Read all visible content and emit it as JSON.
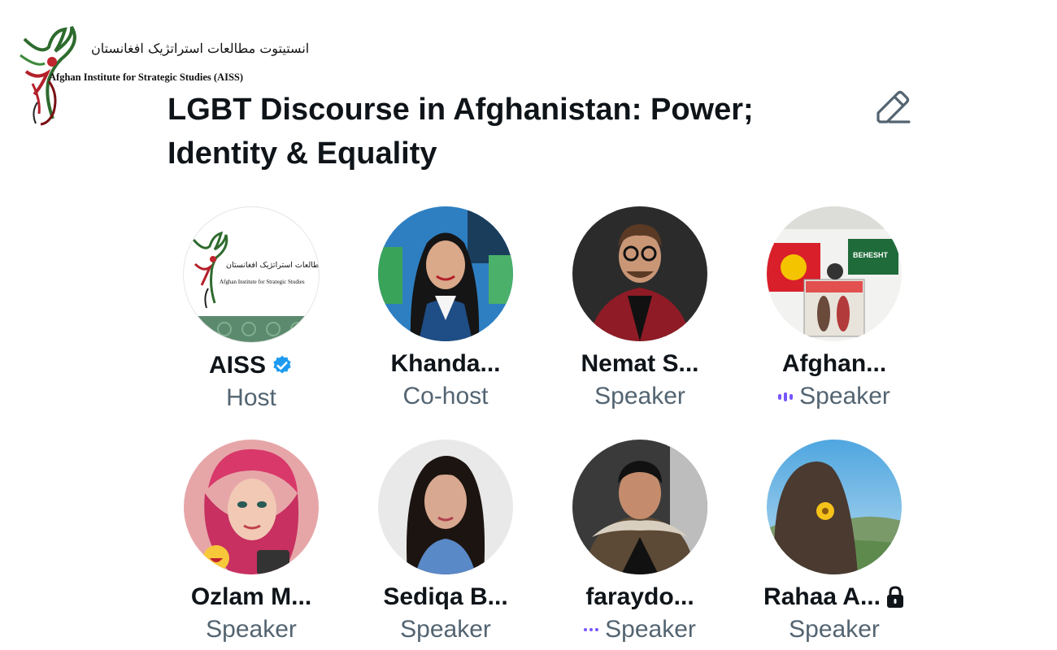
{
  "watermark": {
    "persian": "انستیتوت مطالعات استراتژیک افغانستان",
    "english": "Afghan Institute for Strategic Studies (AISS)"
  },
  "space": {
    "title_line1": "LGBT Discourse in Afghanistan: Power;",
    "title_line2": "Identity & Equality"
  },
  "participants": [
    {
      "name": "AISS",
      "role": "Host",
      "verified": true,
      "logo_persian": "انستیتوت مطالعات استراتژیک افغانستان",
      "logo_english": "Afghan Institute for Strategic Studies"
    },
    {
      "name": "Khanda...",
      "role": "Co-host"
    },
    {
      "name": "Nemat S...",
      "role": "Speaker"
    },
    {
      "name": "Afghan...",
      "role": "Speaker",
      "status": "speaking",
      "poster_text": "BEHESHT"
    },
    {
      "name": "Ozlam M...",
      "role": "Speaker"
    },
    {
      "name": "Sediqa B...",
      "role": "Speaker"
    },
    {
      "name": "faraydo...",
      "role": "Speaker",
      "status": "idle"
    },
    {
      "name": "Rahaa A...",
      "role": "Speaker",
      "locked": true
    }
  ],
  "colors": {
    "text": "#0f1419",
    "secondary": "#536471",
    "verified": "#1d9bf0",
    "speaking": "#7856ff"
  },
  "icons": [
    "edit-icon",
    "verified-badge-icon",
    "speaking-indicator-icon",
    "dots-indicator-icon",
    "lock-icon"
  ]
}
